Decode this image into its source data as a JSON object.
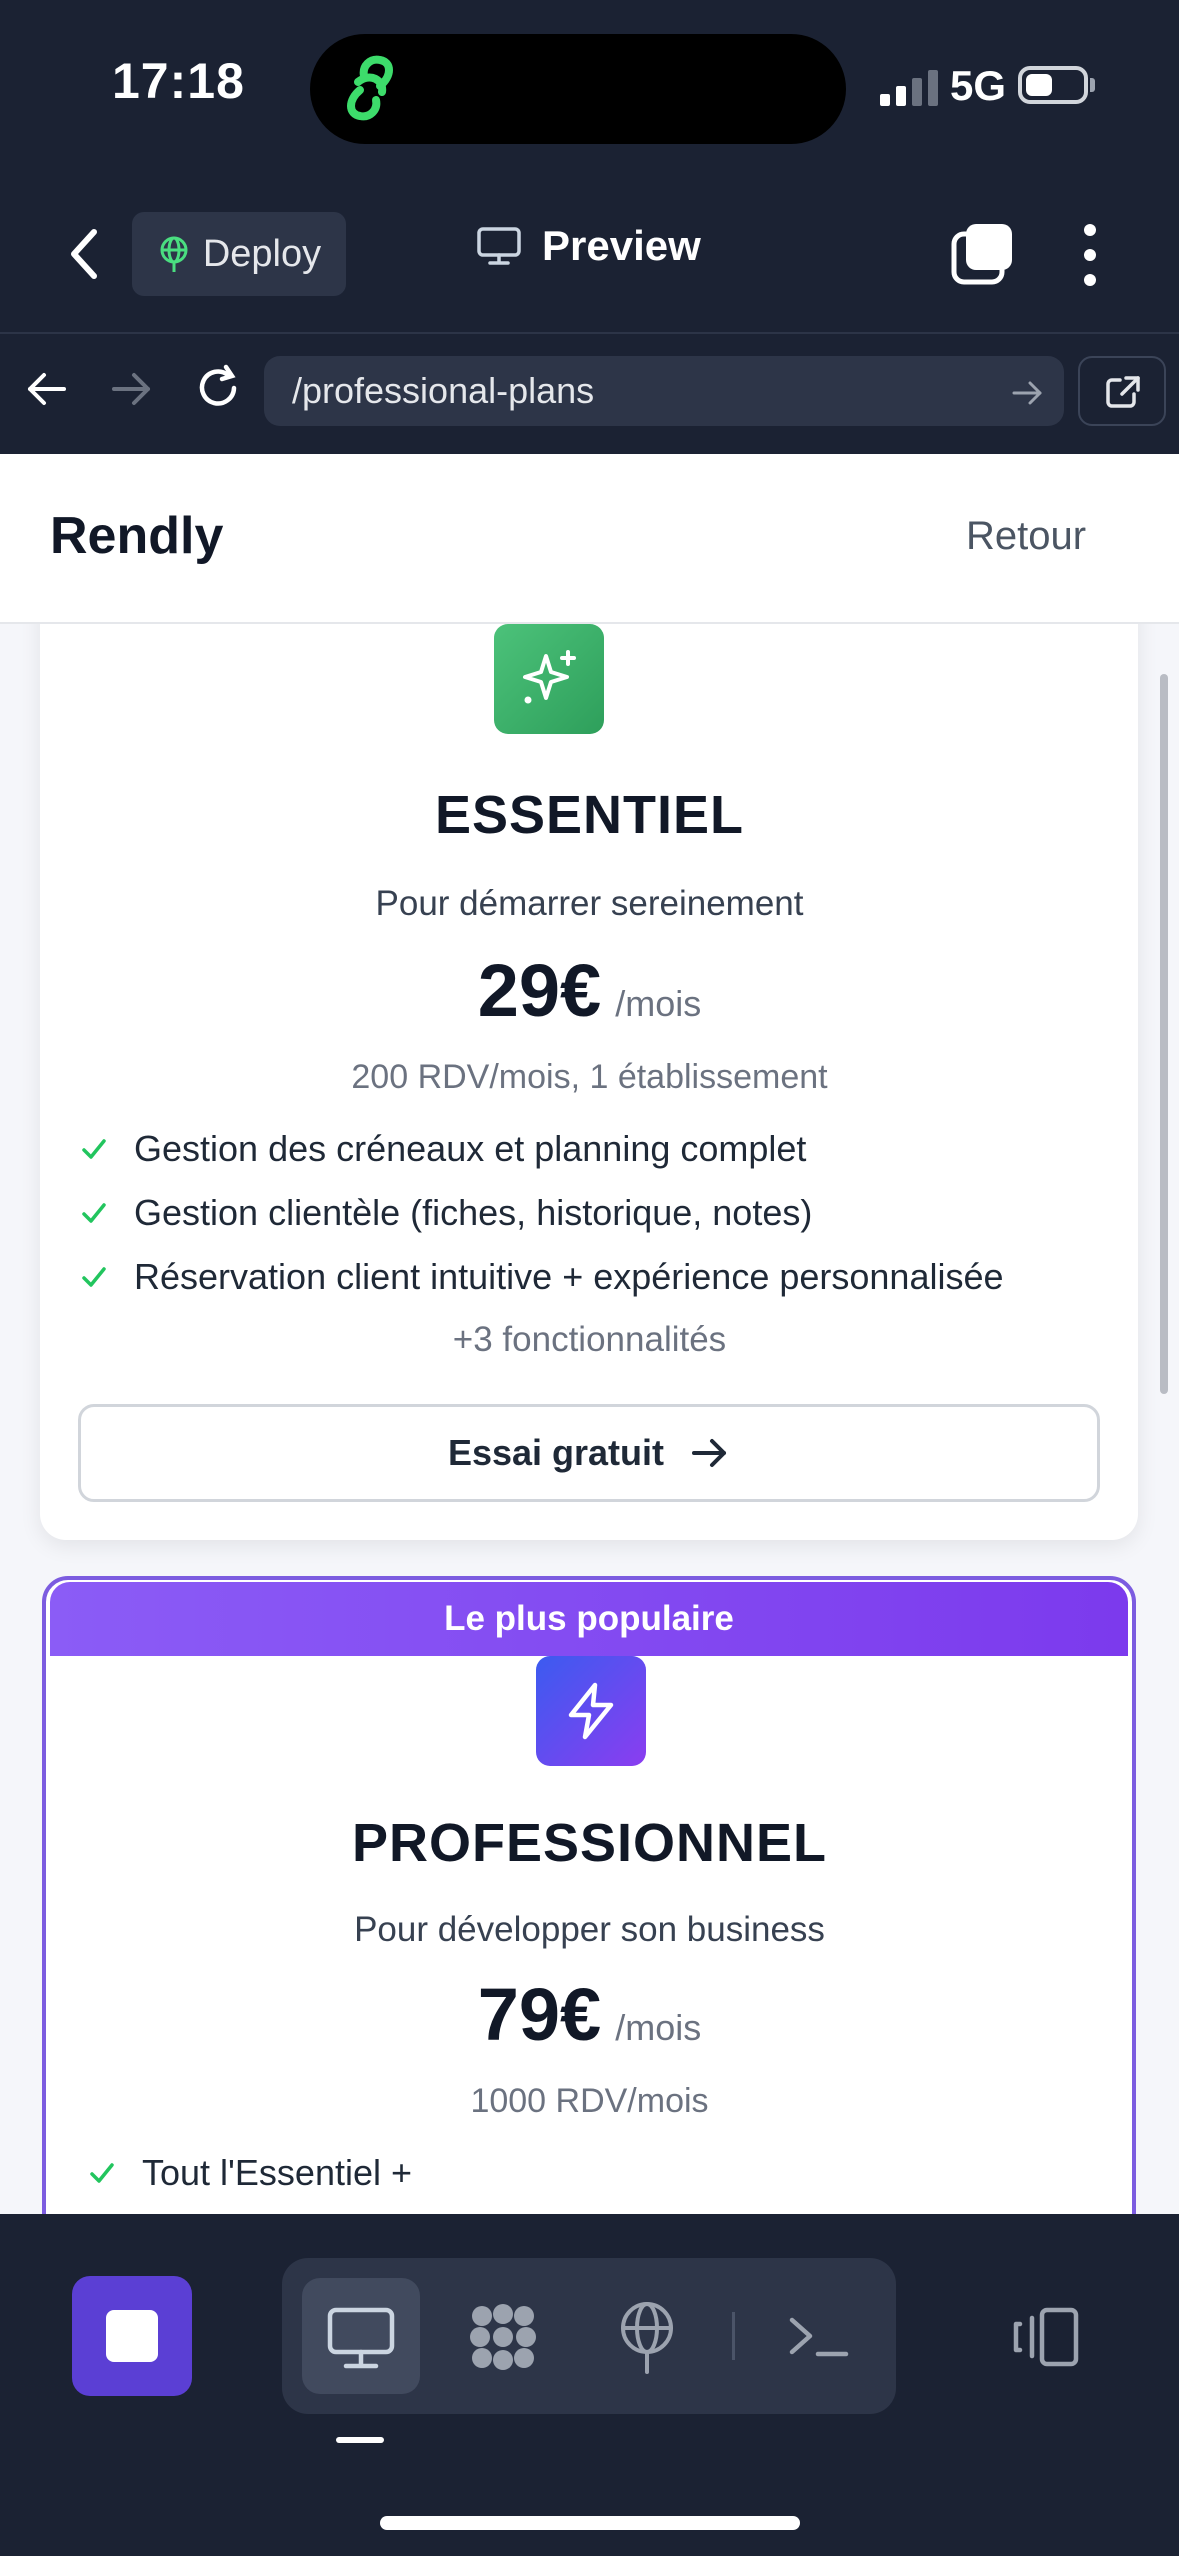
{
  "status_bar": {
    "time": "17:18",
    "network": "5G"
  },
  "app_header": {
    "deploy_label": "Deploy",
    "preview_label": "Preview"
  },
  "url_bar": {
    "url": "/professional-plans"
  },
  "site": {
    "brand": "Rendly",
    "back_link": "Retour"
  },
  "plans": [
    {
      "name": "ESSENTIEL",
      "subtitle": "Pour démarrer sereinement",
      "price": "29€",
      "period": "/mois",
      "quota": "200 RDV/mois, 1 établissement",
      "features": [
        "Gestion des créneaux et planning complet",
        "Gestion clientèle (fiches, historique, notes)",
        "Réservation client intuitive + expérience personnalisée"
      ],
      "more": "+3 fonctionnalités",
      "cta": "Essai gratuit",
      "icon": "sparkles-icon",
      "accent": "#3fb36b"
    },
    {
      "badge": "Le plus populaire",
      "name": "PROFESSIONNEL",
      "subtitle": "Pour développer son business",
      "price": "79€",
      "period": "/mois",
      "quota": "1000 RDV/mois",
      "features": [
        "Tout l'Essentiel +"
      ],
      "icon": "lightning-icon",
      "accent": "#7c3aed"
    }
  ],
  "colors": {
    "chrome_bg": "#1b2233",
    "chrome_surface": "#2d3548",
    "stop_button": "#5b3fd4",
    "check": "#22c55e",
    "popular_border": "#7c5ce0"
  }
}
